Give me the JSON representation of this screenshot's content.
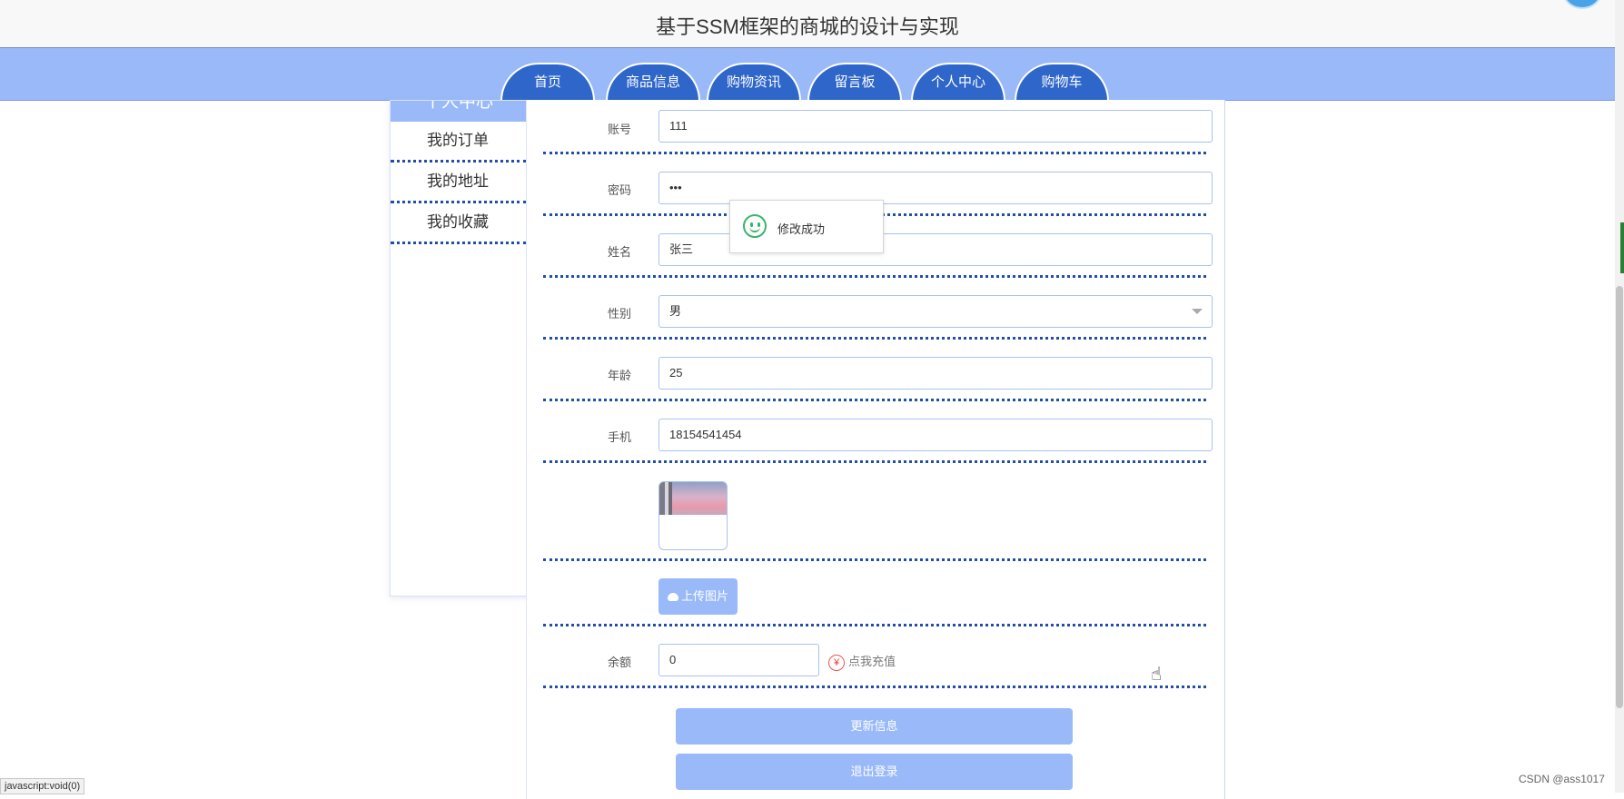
{
  "site": {
    "title": "基于SSM框架的商城的设计与实现"
  },
  "nav": {
    "items": [
      {
        "label": "首页"
      },
      {
        "label": "商品信息"
      },
      {
        "label": "购物资讯"
      },
      {
        "label": "留言板"
      },
      {
        "label": "个人中心"
      },
      {
        "label": "购物车"
      }
    ]
  },
  "sidebar": {
    "heading": "个人中心",
    "items": [
      {
        "label": "我的订单"
      },
      {
        "label": "我的地址"
      },
      {
        "label": "我的收藏"
      }
    ]
  },
  "form": {
    "account": {
      "label": "账号",
      "value": "111"
    },
    "password": {
      "label": "密码",
      "value": "•••"
    },
    "name": {
      "label": "姓名",
      "value": "张三"
    },
    "gender": {
      "label": "性别",
      "value": "男"
    },
    "age": {
      "label": "年龄",
      "value": "25"
    },
    "phone": {
      "label": "手机",
      "value": "18154541454"
    },
    "upload_label": "上传图片",
    "balance": {
      "label": "余额",
      "value": "0"
    },
    "recharge": {
      "symbol": "¥",
      "label": "点我充值"
    },
    "update_button": "更新信息",
    "logout_button": "退出登录"
  },
  "toast": {
    "message": "修改成功",
    "icon": "smile-icon"
  },
  "status_bar": {
    "url": "javascript:void(0)"
  },
  "watermark": {
    "text": "CSDN @ass1017"
  },
  "colors": {
    "nav_bg": "#99b9f9",
    "tab_bg": "#2f66c9",
    "button_bg": "#99b9f9",
    "divider": "#1f4fa8",
    "success": "#3bb36a"
  }
}
